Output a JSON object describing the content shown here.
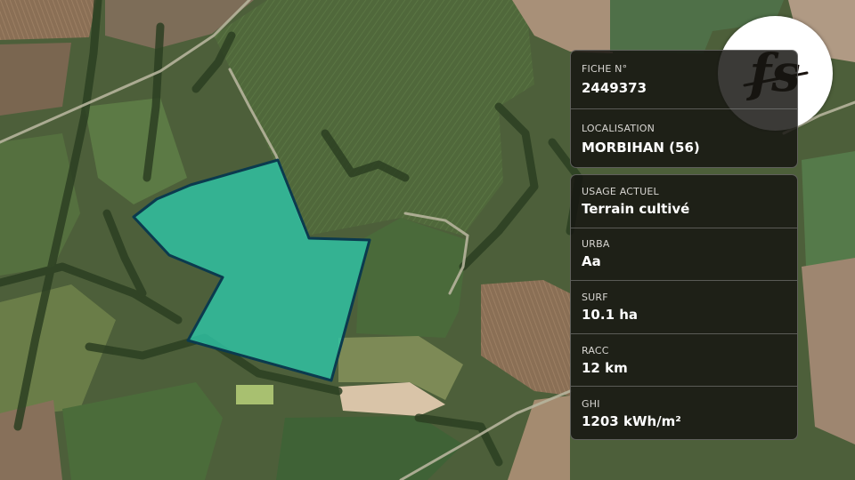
{
  "map": {
    "parcel_fill": "#2ec4a6",
    "parcel_stroke": "#0b3a4e"
  },
  "logo": {
    "text": "fs"
  },
  "card_id": {
    "fiche_label": "FICHE N°",
    "fiche_value": "2449373",
    "localisation_label": "LOCALISATION",
    "localisation_value": "MORBIHAN (56)"
  },
  "card_attrs": {
    "fields": [
      {
        "label": "USAGE ACTUEL",
        "value": "Terrain cultivé"
      },
      {
        "label": "URBA",
        "value": "Aa"
      },
      {
        "label": "SURF",
        "value": "10.1 ha"
      },
      {
        "label": "RACC",
        "value": "12 km"
      },
      {
        "label": "GHI",
        "value": "1203 kWh/m²"
      }
    ]
  }
}
